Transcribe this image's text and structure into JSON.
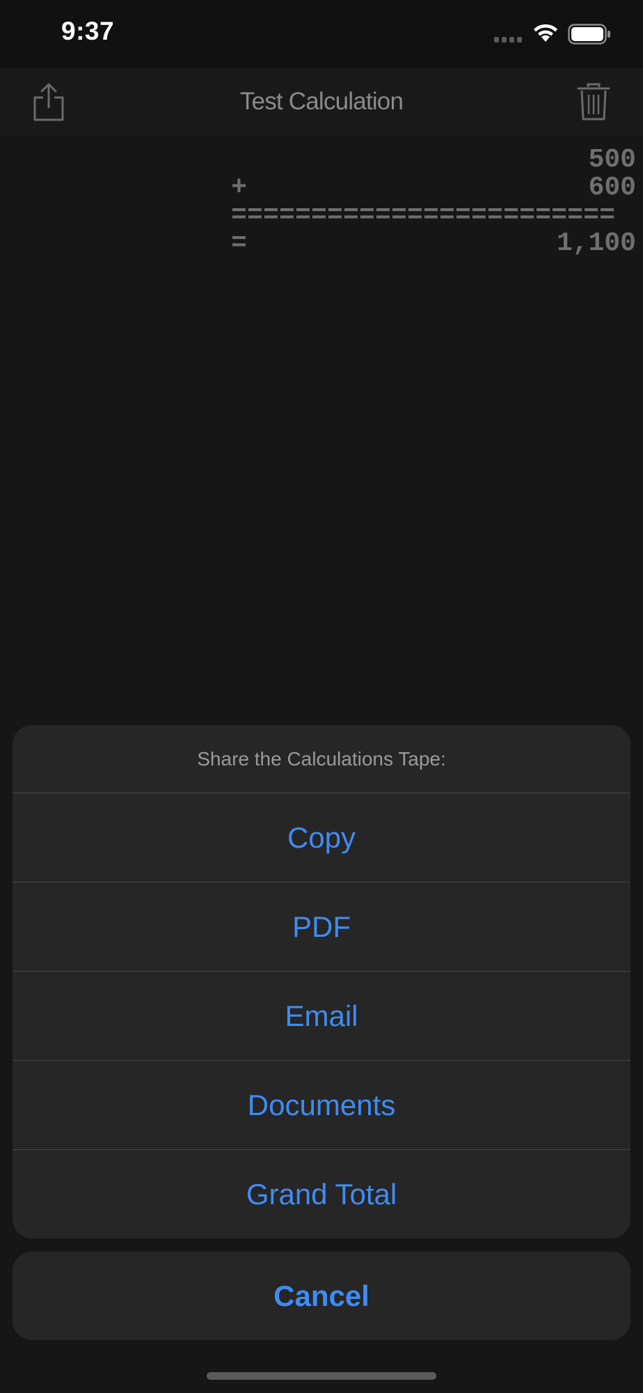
{
  "status_bar": {
    "time": "9:37"
  },
  "nav": {
    "title": "Test Calculation",
    "share_icon": "share-icon",
    "trash_icon": "trash-icon"
  },
  "tape": {
    "lines": [
      {
        "op": "",
        "value": "500"
      },
      {
        "op": "+",
        "value": "600"
      }
    ],
    "separator": "========================",
    "total": {
      "op": "=",
      "value": "1,100"
    }
  },
  "action_sheet": {
    "title": "Share the Calculations Tape:",
    "options": [
      "Copy",
      "PDF",
      "Email",
      "Documents",
      "Grand Total"
    ],
    "cancel": "Cancel"
  },
  "colors": {
    "accent": "#3f8cf2",
    "sheet_bg": "#262626",
    "background": "#161616"
  }
}
